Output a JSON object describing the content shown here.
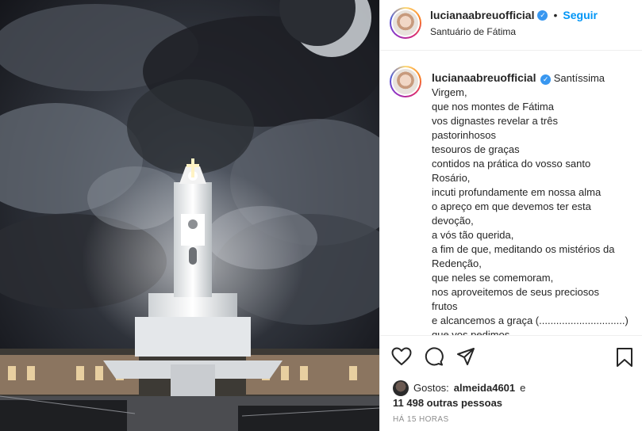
{
  "post": {
    "username": "lucianaabreuofficial",
    "follow_label": "Seguir",
    "separator": "•",
    "location": "Santuário de Fátima",
    "verified_icon": "verified-badge-icon"
  },
  "caption": {
    "username": "lucianaabreuofficial",
    "lines": [
      "Santíssima",
      "Virgem,",
      "que nos montes de Fátima",
      "vos dignastes revelar a três",
      "pastorinhosos",
      "tesouros de graças",
      "contidos na prática do vosso santo",
      "Rosário,",
      "incuti profundamente em nossa alma",
      "o apreço em que devemos ter esta",
      "devoção,",
      "a vós tão querida,",
      "a fim de que, meditando os mistérios da",
      "Redenção,",
      "que neles se comemoram,",
      "nos aproveitemos de seus preciosos",
      "frutos",
      "e alcancemos a graça (..............................)",
      "que vos pedimos"
    ]
  },
  "likes": {
    "prefix": "Gostos:",
    "user": "almeida4601",
    "conjunction": "e",
    "others": "11 498 outras pessoas"
  },
  "timestamp": "HÁ 15 HORAS",
  "icons": {
    "like": "heart-icon",
    "comment": "comment-icon",
    "share": "share-icon",
    "save": "bookmark-icon"
  }
}
